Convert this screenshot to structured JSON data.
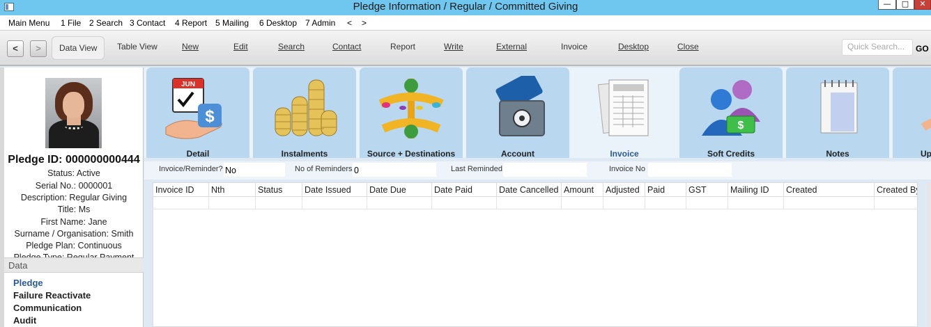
{
  "window": {
    "title": "Pledge Information / Regular / Committed Giving"
  },
  "menu": {
    "items": [
      "Main Menu",
      "1 File",
      "2 Search",
      "3 Contact",
      "4 Report",
      "5 Mailing",
      "6 Desktop",
      "7 Admin",
      "<",
      ">"
    ]
  },
  "toolbar": {
    "back": "<",
    "forward": ">",
    "buttons": [
      "Data View",
      "Table View",
      "New",
      "Edit",
      "Search",
      "Contact",
      "Report",
      "Write",
      "External",
      "Invoice",
      "Desktop",
      "Close"
    ],
    "quick_search_placeholder": "Quick Search...",
    "go": "GO"
  },
  "left": {
    "pledge_id": "Pledge ID: 000000000444",
    "info": [
      "Status: Active",
      "Serial No.: 0000001",
      "Description: Regular Giving",
      "Title: Ms",
      "First Name: Jane",
      "Surname / Organisation: Smith",
      "Pledge Plan: Continuous",
      "Pledge Type: Regular Payment"
    ],
    "data_header": "Data",
    "nav": [
      "Pledge",
      "Failure Reactivate",
      "Communication",
      "Audit"
    ],
    "current_nav": "Pledge"
  },
  "tabs": [
    {
      "label": "Detail",
      "icon": "calendar-hand-icon"
    },
    {
      "label": "Instalments",
      "icon": "coin-stacks-icon"
    },
    {
      "label": "Source + Destinations",
      "icon": "dollar-arrows-icon"
    },
    {
      "label": "Account",
      "icon": "credit-card-safe-icon"
    },
    {
      "label": "Invoice",
      "icon": "invoice-document-icon"
    },
    {
      "label": "Soft Credits",
      "icon": "people-money-icon"
    },
    {
      "label": "Notes",
      "icon": "notepad-icon"
    },
    {
      "label": "Upgr",
      "icon": "upgrade-icon"
    }
  ],
  "active_tab": "Invoice",
  "filters": {
    "invoice_reminder_label": "Invoice/Reminder?",
    "invoice_reminder_value": "No",
    "no_of_reminders_label": "No of Reminders",
    "no_of_reminders_value": "0",
    "last_reminded_label": "Last Reminded",
    "last_reminded_value": "",
    "invoice_no_label": "Invoice No",
    "invoice_no_value": ""
  },
  "table": {
    "columns": [
      "Invoice ID",
      "Nth",
      "Status",
      "Date Issued",
      "Date Due",
      "Date Paid",
      "Date Cancelled",
      "Amount",
      "Adjusted",
      "Paid",
      "GST",
      "Mailing ID",
      "Created",
      "Created By"
    ],
    "rows": []
  },
  "colors": {
    "titlebar": "#6fc6ee",
    "tab_inactive": "#b9d7ef",
    "tab_active": "#eaf2fa",
    "link_active": "#2a5a94"
  }
}
